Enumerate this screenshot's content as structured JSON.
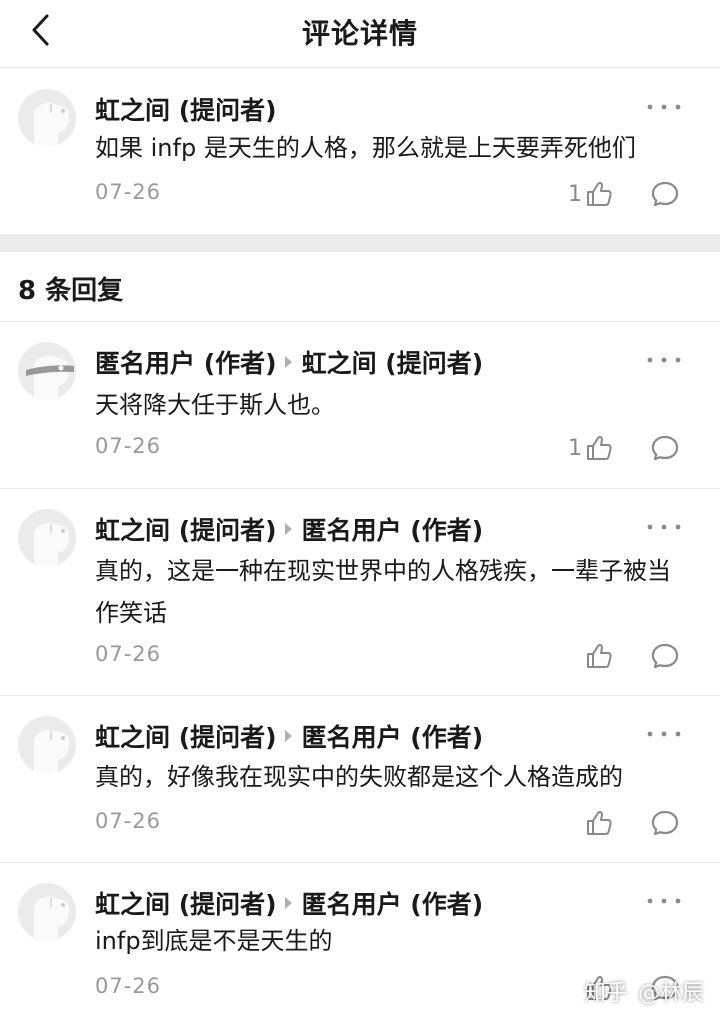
{
  "nav": {
    "title": "评论详情"
  },
  "root_comment": {
    "author": "虹之间 (提问者)",
    "text": "如果 infp 是天生的人格，那么就是上天要弄死他们",
    "date": "07-26",
    "likes": "1"
  },
  "replies_header": "8 条回复",
  "replies": [
    {
      "author": "匿名用户 (作者)",
      "reply_to": "虹之间 (提问者)",
      "text": "天将降大任于斯人也。",
      "date": "07-26",
      "likes": "1"
    },
    {
      "author": "虹之间 (提问者)",
      "reply_to": "匿名用户 (作者)",
      "text": "真的，这是一种在现实世界中的人格残疾，一辈子被当作笑话",
      "date": "07-26",
      "likes": ""
    },
    {
      "author": "虹之间 (提问者)",
      "reply_to": "匿名用户 (作者)",
      "text": "真的，好像我在现实中的失败都是这个人格造成的",
      "date": "07-26",
      "likes": ""
    },
    {
      "author": "虹之间 (提问者)",
      "reply_to": "匿名用户 (作者)",
      "text": "infp到底是不是天生的",
      "date": "07-26",
      "likes": ""
    }
  ],
  "watermark": {
    "site": "知乎",
    "user": "@林辰"
  },
  "icons": {
    "back": "chevron-left-icon",
    "more": "more-dots-icon",
    "like": "thumb-up-icon",
    "reply": "comment-bubble-icon",
    "avatar": "default-avatar-icon"
  },
  "colors": {
    "text": "#1a1a1a",
    "muted": "#999999",
    "icon": "#8a8a8a",
    "divider": "#e6e6e6",
    "gap": "#ebebeb"
  }
}
